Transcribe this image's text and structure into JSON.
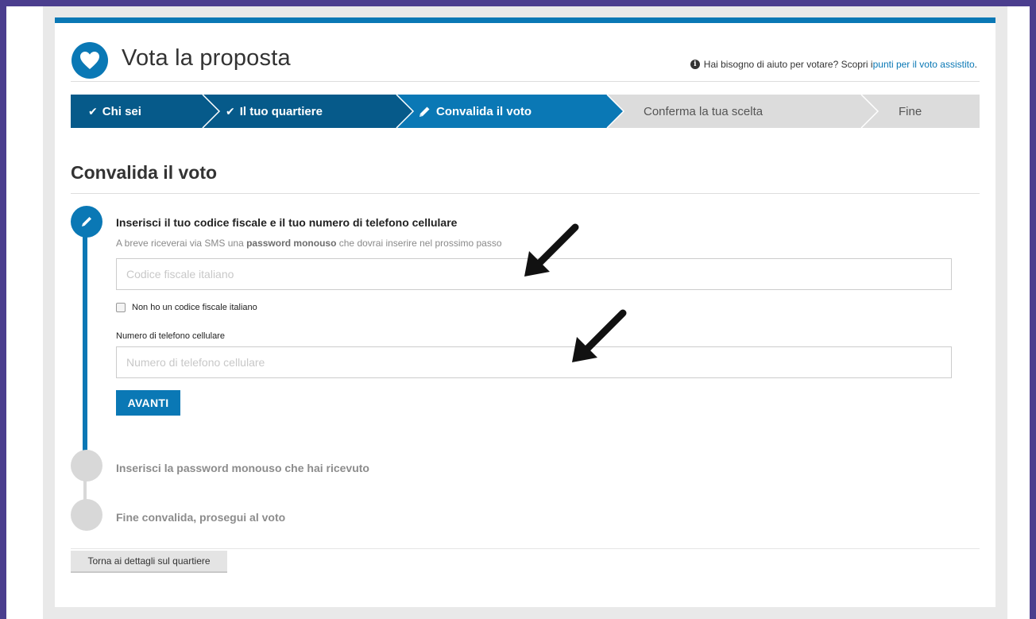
{
  "header": {
    "title": "Vota la proposta",
    "help_text": "Hai bisogno di aiuto per votare? Scopri i ",
    "help_link": "punti per il voto assistito",
    "help_suffix": "."
  },
  "stepper": {
    "steps": [
      {
        "label": "Chi sei",
        "state": "done"
      },
      {
        "label": "Il tuo quartiere",
        "state": "done"
      },
      {
        "label": "Convalida il voto",
        "state": "active"
      },
      {
        "label": "Conferma la tua scelta",
        "state": "pending"
      },
      {
        "label": "Fine",
        "state": "pending"
      }
    ]
  },
  "section": {
    "title": "Convalida il voto"
  },
  "step1": {
    "heading": "Inserisci il tuo codice fiscale e il tuo numero di telefono cellulare",
    "sub_prefix": "A breve riceverai via SMS una ",
    "sub_bold": "password monouso",
    "sub_suffix": " che dovrai inserire nel prossimo passo",
    "codice_placeholder": "Codice fiscale italiano",
    "checkbox_label": "Non ho un codice fiscale italiano",
    "phone_label": "Numero di telefono cellulare",
    "phone_placeholder": "Numero di telefono cellulare",
    "submit_label": "AVANTI"
  },
  "step2": {
    "heading": "Inserisci la password monouso che hai ricevuto"
  },
  "step3": {
    "heading": "Fine convalida, prosegui al voto"
  },
  "footer": {
    "back_label": "Torna ai dettagli sul quartiere"
  },
  "colors": {
    "primary": "#0a78b5",
    "primary_dark": "#065a8a",
    "pending_step": "#dcdcdc",
    "frame": "#4b3e8e"
  },
  "icons": [
    "heart-icon",
    "info-icon",
    "check-icon",
    "pencil-icon",
    "arrow-annotation-icon"
  ]
}
